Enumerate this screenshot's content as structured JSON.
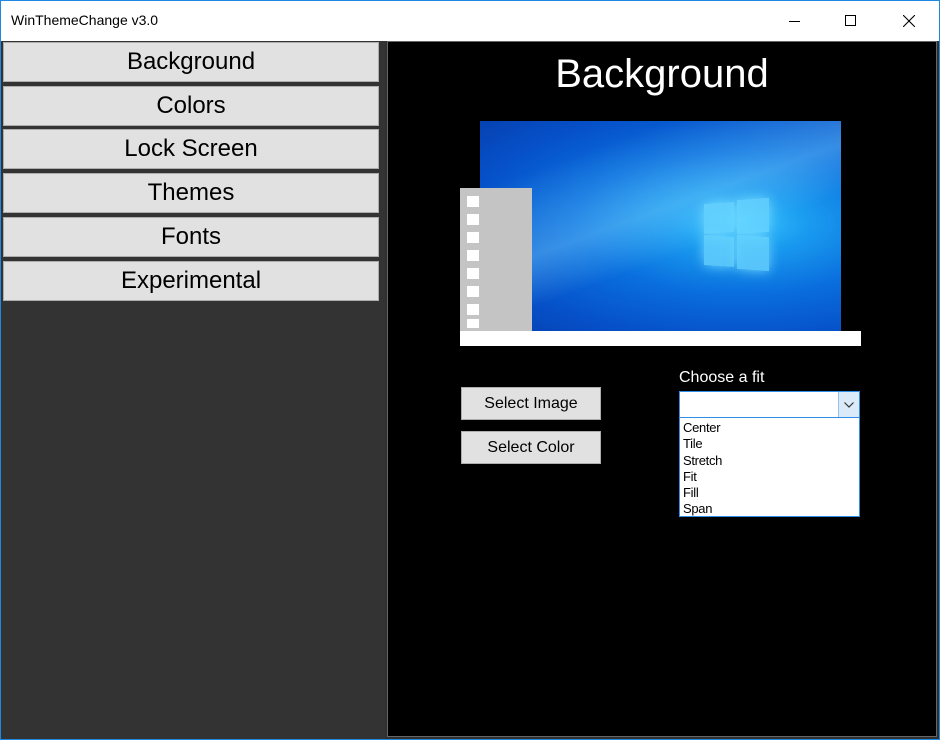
{
  "window": {
    "title": "WinThemeChange v3.0"
  },
  "sidebar": {
    "items": [
      {
        "label": "Background"
      },
      {
        "label": "Colors"
      },
      {
        "label": "Lock Screen"
      },
      {
        "label": "Themes"
      },
      {
        "label": "Fonts"
      },
      {
        "label": "Experimental"
      }
    ]
  },
  "main": {
    "heading": "Background",
    "select_image_label": "Select Image",
    "select_color_label": "Select Color",
    "fit": {
      "label": "Choose a fit",
      "current_value": "",
      "options": [
        "Center",
        "Tile",
        "Stretch",
        "Fit",
        "Fill",
        "Span"
      ]
    }
  },
  "colors": {
    "accent": "#1e88e5",
    "panel_bg": "#000000",
    "sidebar_bg": "#333333",
    "button_bg": "#e1e1e1"
  }
}
